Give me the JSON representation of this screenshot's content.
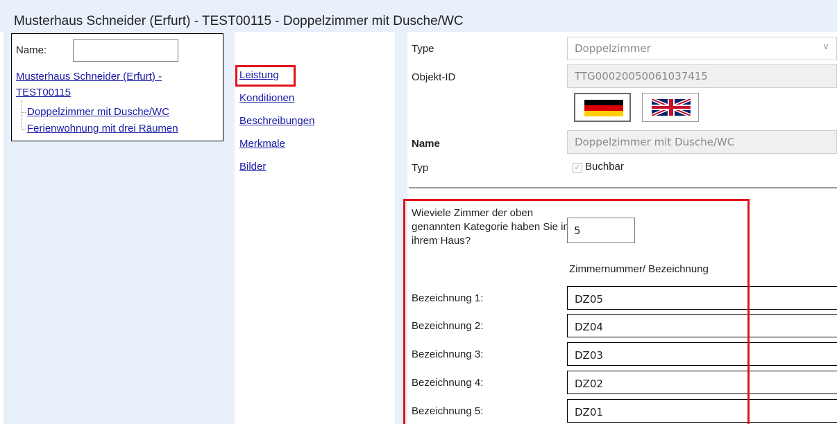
{
  "window": {
    "title": "Musterhaus Schneider (Erfurt) - TEST00115 - Doppelzimmer mit Dusche/WC"
  },
  "nav": {
    "name_label": "Name:",
    "name_value": "",
    "tree": {
      "root_line1": "Musterhaus Schneider (Erfurt) -",
      "root_line2": "TEST00115",
      "children": [
        "Doppelzimmer mit Dusche/WC",
        "Ferienwohnung mit drei Räumen"
      ]
    }
  },
  "tabs": [
    "Leistung",
    "Konditionen",
    "Beschreibungen",
    "Merkmale",
    "Bilder"
  ],
  "active_tab": "Leistung",
  "form": {
    "type_label": "Type",
    "type_value": "Doppelzimmer",
    "objekt_id_label": "Objekt-ID",
    "objekt_id_value": "TTG00020050061037415",
    "languages": [
      "german-flag-icon",
      "uk-flag-icon"
    ],
    "name_label": "Name",
    "name_value": "Doppelzimmer mit Dusche/WC",
    "typ_label": "Typ",
    "buchbar_label": "Buchbar",
    "buchbar_checked": true
  },
  "rooms": {
    "question": "Wieviele Zimmer der oben genannten Kategorie haben Sie in ihrem Haus?",
    "count": "5",
    "column_header": "Zimmernummer/ Bezeichnung",
    "items": [
      {
        "label": "Bezeichnung 1:",
        "value": "DZ05"
      },
      {
        "label": "Bezeichnung 2:",
        "value": "DZ04"
      },
      {
        "label": "Bezeichnung 3:",
        "value": "DZ03"
      },
      {
        "label": "Bezeichnung 4:",
        "value": "DZ02"
      },
      {
        "label": "Bezeichnung 5:",
        "value": "DZ01"
      }
    ]
  },
  "colors": {
    "panel_bg": "#e8f0fb",
    "link": "#1a1aa6",
    "highlight": "#e3101a"
  }
}
